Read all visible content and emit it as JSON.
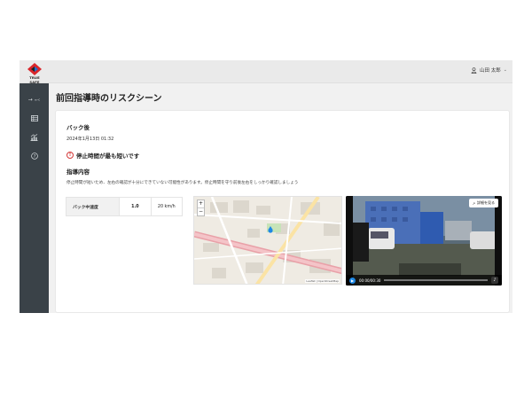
{
  "brand": {
    "logo_text": "TRUE SAFE"
  },
  "header": {
    "user_name": "山田 太郎",
    "user_icon": "person-icon",
    "menu_icon": "chevron-down-icon"
  },
  "sidebar": {
    "collapse_label": "→",
    "collapse_sub": "≡<",
    "items": [
      {
        "icon": "table-icon"
      },
      {
        "icon": "chart-icon"
      },
      {
        "icon": "help-icon"
      }
    ]
  },
  "page": {
    "title": "前回指導時のリスクシーン"
  },
  "scene": {
    "section_title": "バック後",
    "datetime": "2024年1月13日 01:32",
    "warning": "停止時間が最も短いです",
    "guidance_title": "指導内容",
    "guidance_text": "停止時間が短いため、左右の確認が十分にできていない可能性があります。停止時間を守り前後左右をしっかり確認しましょう",
    "table": {
      "header": "バック中速度",
      "value_a": "1.0",
      "value_b": "20 km/h"
    }
  },
  "map": {
    "zoom_in": "+",
    "zoom_out": "−",
    "attribution": "Leaflet | OpenStreetMap"
  },
  "video": {
    "detail_button": "詳細を見る",
    "time": "00:00/00:30",
    "progress": 0.0
  },
  "colors": {
    "sidebar": "#3a4248",
    "accent": "#1e88e5",
    "warning": "#d43a3a",
    "brand_red": "#d9262b",
    "brand_blue": "#1a6fd1"
  }
}
